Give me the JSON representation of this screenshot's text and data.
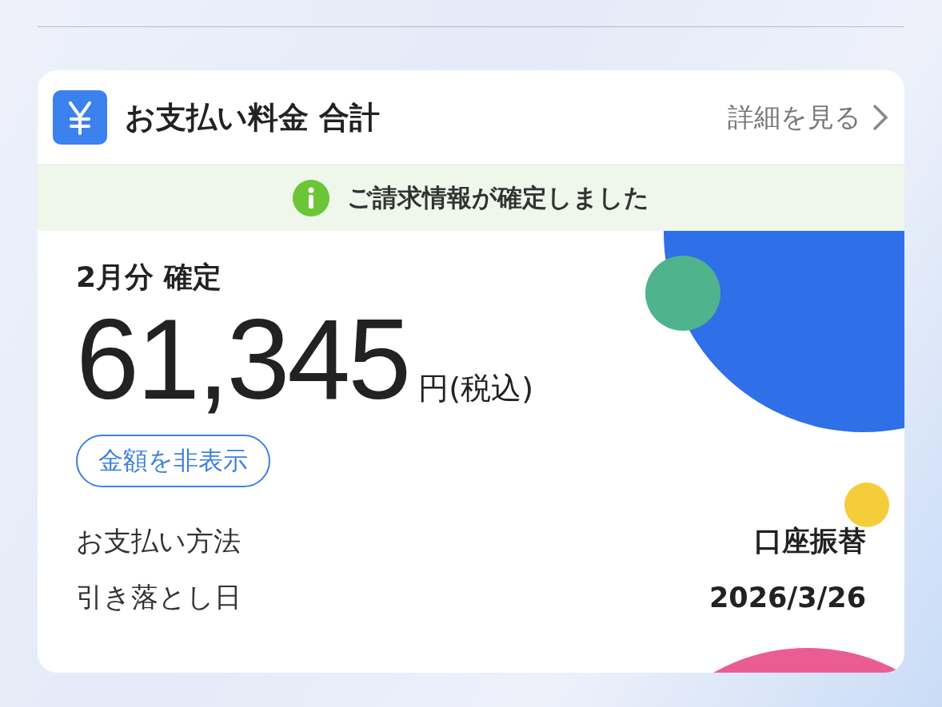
{
  "card": {
    "title": "お支払い料金 合計",
    "details_link": "詳細を見る",
    "notice": "ご請求情報が確定しました",
    "period": "2月分 確定",
    "amount": "61,345",
    "unit": "円(税込)",
    "hide_button": "金額を非表示",
    "rows": [
      {
        "label": "お支払い方法",
        "value": "口座振替"
      },
      {
        "label": "引き落とし日",
        "value": "2026/3/26"
      }
    ]
  }
}
